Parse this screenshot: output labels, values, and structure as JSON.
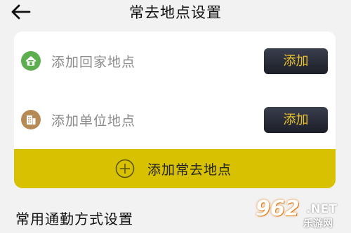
{
  "header": {
    "back_icon": "arrow-left-icon",
    "title": "常去地点设置"
  },
  "card": {
    "home": {
      "icon": "home-icon",
      "label": "添加回家地点",
      "button": "添加"
    },
    "work": {
      "icon": "office-icon",
      "label": "添加单位地点",
      "button": "添加"
    },
    "add_frequent": {
      "icon": "plus-circle-icon",
      "label": "添加常去地点"
    }
  },
  "section": {
    "commute_title": "常用通勤方式设置"
  },
  "watermark": {
    "logo": "962",
    "domain_suffix": ".NET",
    "text": "乐游网"
  },
  "colors": {
    "page_bg": "#f2f2f2",
    "card_bg": "#ffffff",
    "accent_yellow": "#d8c100",
    "button_dark": "#262a36",
    "button_text": "#e9c12d",
    "home_icon": "#5cae4f",
    "office_icon": "#b58a55"
  }
}
